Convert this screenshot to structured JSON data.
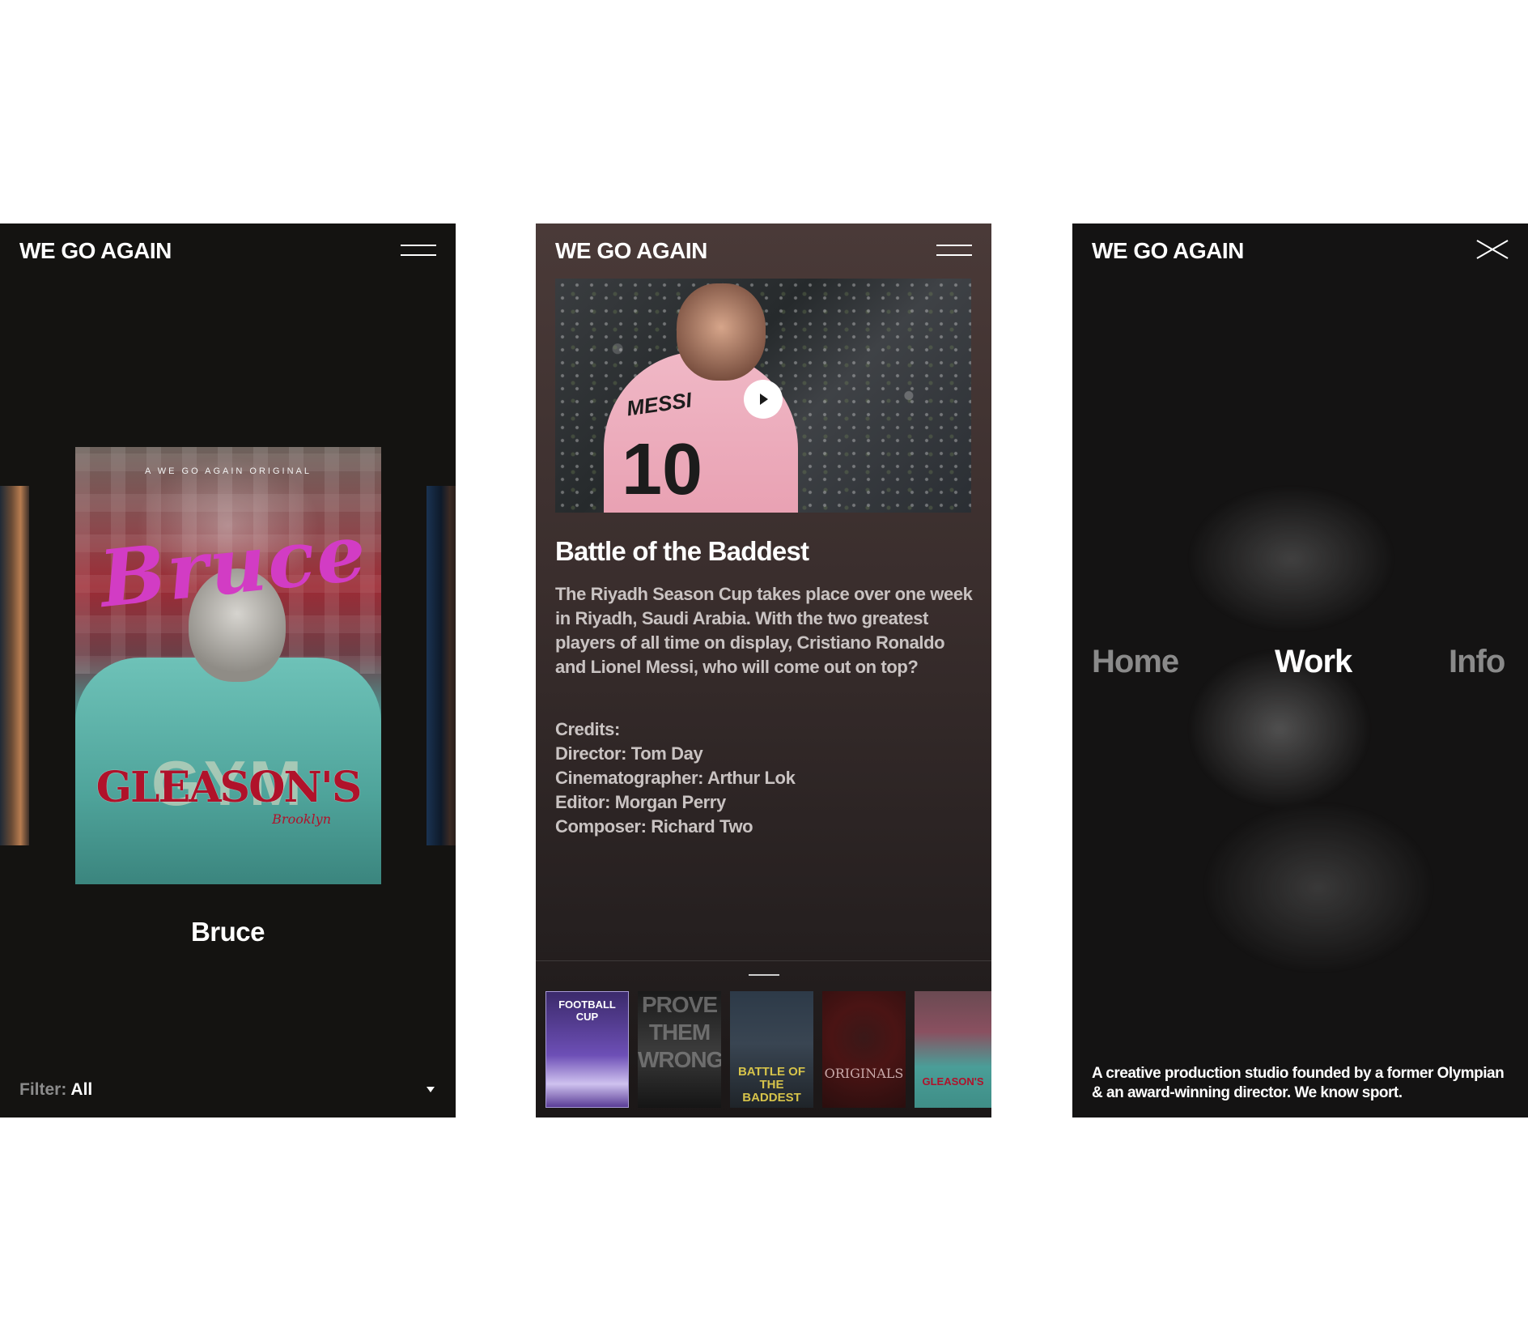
{
  "brand": "WE GO AGAIN",
  "screens": {
    "portfolio": {
      "poster": {
        "kicker": "A WE GO AGAIN ORIGINAL",
        "script_title": "Bruce",
        "badge_bg": "GYM",
        "badge": "GLEASON'S",
        "badge_sub": "Brooklyn"
      },
      "title": "Bruce",
      "filter": {
        "label": "Filter:",
        "value": "All"
      }
    },
    "project": {
      "title": "Battle of the Baddest",
      "jersey_name": "MESSI",
      "jersey_number": "10",
      "description": "The Riyadh Season Cup takes place over one week in Riyadh, Saudi Arabia. With the two greatest players of all time on display, Cristiano Ronaldo and Lionel Messi, who will come out on top?",
      "credits": [
        "Credits:",
        "Director: Tom Day",
        "Cinematographer: Arthur Lok",
        "Editor: Morgan Perry",
        "Composer: Richard Two"
      ],
      "thumbnails": [
        "FOOTBALL CUP",
        "PROVE THEM WRONG",
        "BATTLE OF THE BADDEST",
        "ORIGINALS",
        "GLEASON'S"
      ]
    },
    "menu": {
      "nav": [
        "Home",
        "Work",
        "Info"
      ],
      "active": "Work",
      "tagline": "A creative production studio founded by a former Olympian & an award-winning director. We know sport."
    }
  },
  "colors": {
    "background": "#ffffff",
    "screen_dark": "#141311",
    "project_top": "#4a3a38",
    "nav_inactive": "#8a8a8a",
    "nav_active": "#ffffff",
    "poster_script": "#d23cc4",
    "badge_red": "#b0122a"
  },
  "icons": [
    "hamburger-menu-icon",
    "play-icon",
    "close-icon",
    "caret-down-icon"
  ]
}
